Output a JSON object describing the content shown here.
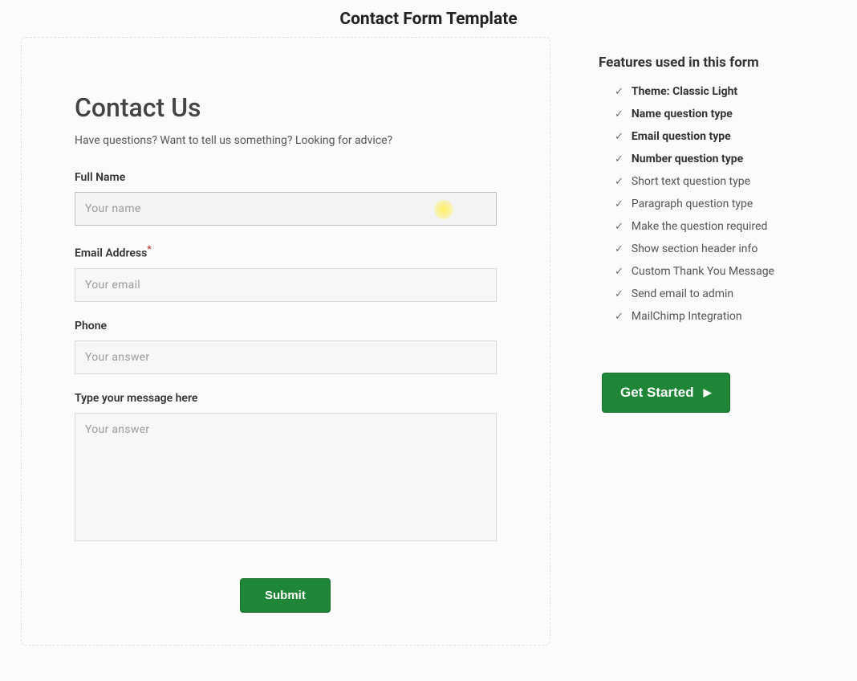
{
  "page_title": "Contact Form Template",
  "form": {
    "heading": "Contact Us",
    "subheading": "Have questions? Want to tell us something? Looking for advice?",
    "fields": {
      "name": {
        "label": "Full Name",
        "placeholder": "Your name"
      },
      "email": {
        "label": "Email Address",
        "placeholder": "Your email",
        "required_mark": "*"
      },
      "phone": {
        "label": "Phone",
        "placeholder": "Your answer"
      },
      "message": {
        "label": "Type your message here",
        "placeholder": "Your answer"
      }
    },
    "submit_label": "Submit"
  },
  "sidebar": {
    "title": "Features used in this form",
    "features": [
      {
        "text": "Theme: Classic Light",
        "bold": true
      },
      {
        "text": "Name question type",
        "bold": true
      },
      {
        "text": "Email question type",
        "bold": true
      },
      {
        "text": "Number question type",
        "bold": true
      },
      {
        "text": "Short text question type",
        "bold": false
      },
      {
        "text": "Paragraph question type",
        "bold": false
      },
      {
        "text": "Make the question required",
        "bold": false
      },
      {
        "text": "Show section header info",
        "bold": false
      },
      {
        "text": "Custom Thank You Message",
        "bold": false
      },
      {
        "text": "Send email to admin",
        "bold": false
      },
      {
        "text": "MailChimp Integration",
        "bold": false
      }
    ],
    "cta_label": "Get Started"
  }
}
